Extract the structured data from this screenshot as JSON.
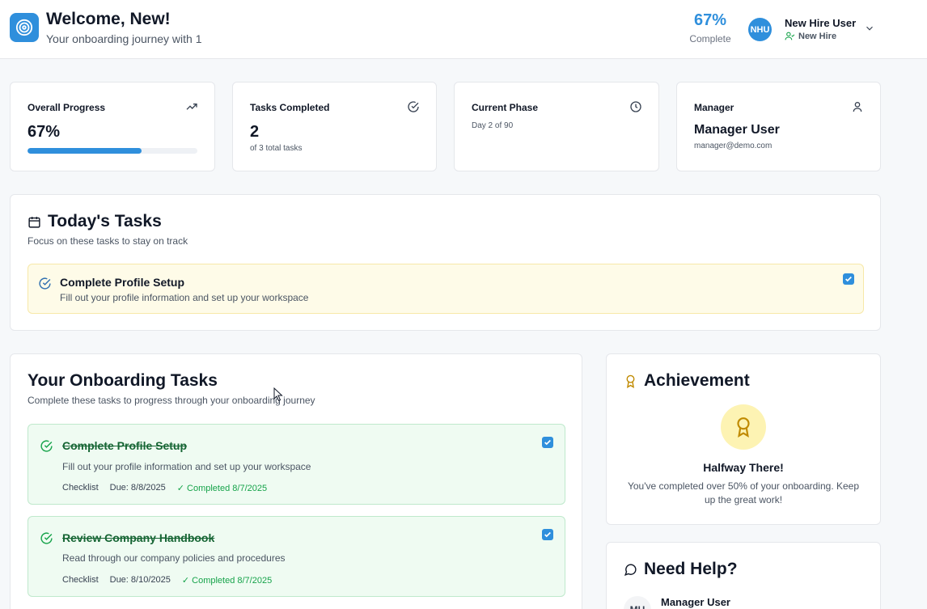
{
  "header": {
    "welcome": "Welcome, New!",
    "subtitle": "Your onboarding journey with 1",
    "progress_pct": "67%",
    "progress_label": "Complete",
    "avatar_initials": "NHU",
    "user_name": "New Hire User",
    "user_role": "New Hire"
  },
  "stats": {
    "overall": {
      "title": "Overall Progress",
      "value": "67%",
      "progress": 0.67
    },
    "tasks": {
      "title": "Tasks Completed",
      "value": "2",
      "sub": "of 3 total tasks"
    },
    "phase": {
      "title": "Current Phase",
      "sub": "Day 2 of 90"
    },
    "manager": {
      "title": "Manager",
      "name": "Manager User",
      "email": "manager@demo.com"
    }
  },
  "today": {
    "title": "Today's Tasks",
    "subtitle": "Focus on these tasks to stay on track",
    "tasks": [
      {
        "title": "Complete Profile Setup",
        "desc": "Fill out your profile information and set up your workspace",
        "checked": true
      }
    ]
  },
  "onboarding": {
    "title": "Your Onboarding Tasks",
    "subtitle": "Complete these tasks to progress through your onboarding journey",
    "tasks": [
      {
        "title": "Complete Profile Setup",
        "desc": "Fill out your profile information and set up your workspace",
        "type": "Checklist",
        "due": "Due: 8/8/2025",
        "completed": "✓ Completed 8/7/2025",
        "checked": true
      },
      {
        "title": "Review Company Handbook",
        "desc": "Read through our company policies and procedures",
        "type": "Checklist",
        "due": "Due: 8/10/2025",
        "completed": "✓ Completed 8/7/2025",
        "checked": true
      }
    ]
  },
  "achievement": {
    "title": "Achievement",
    "badge_title": "Halfway There!",
    "badge_desc": "You've completed over 50% of your onboarding. Keep up the great work!"
  },
  "help": {
    "title": "Need Help?",
    "contact_initials": "MU",
    "contact_name": "Manager User"
  },
  "colors": {
    "accent": "#2f8fdc",
    "success": "#16a34a",
    "today_bg": "#fefbe8",
    "done_bg": "#effbf2",
    "achievement": "#c08a00"
  }
}
